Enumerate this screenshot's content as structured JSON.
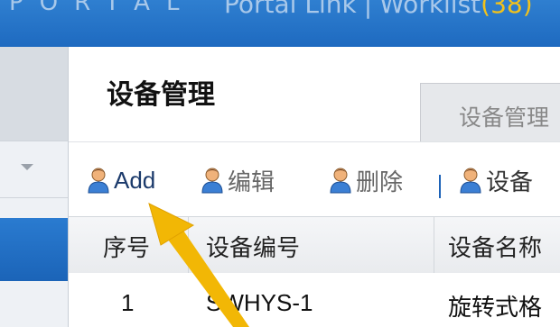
{
  "header": {
    "brand": "PORTAL",
    "links": {
      "portal_link": "Portal Link",
      "separator": "|",
      "worklist_label": "Worklist",
      "worklist_count": "(38)"
    }
  },
  "page": {
    "title": "设备管理",
    "active_tab": "设备管理"
  },
  "toolbar": {
    "add_label": "Add",
    "edit_label": "编辑",
    "delete_label": "删除",
    "separator": "|",
    "device_label": "设备"
  },
  "grid": {
    "columns": [
      "序号",
      "设备编号",
      "设备名称"
    ],
    "rows": [
      {
        "index": "1",
        "code": "SWHYS-1",
        "name": "旋转式格"
      }
    ]
  },
  "colors": {
    "header_blue": "#1e6ac0",
    "arrow": "#f2b705",
    "count_yellow": "#f2c21a"
  },
  "icons": {
    "user": "user-icon",
    "caret": "chevron-down-icon",
    "arrow": "annotation-arrow"
  }
}
